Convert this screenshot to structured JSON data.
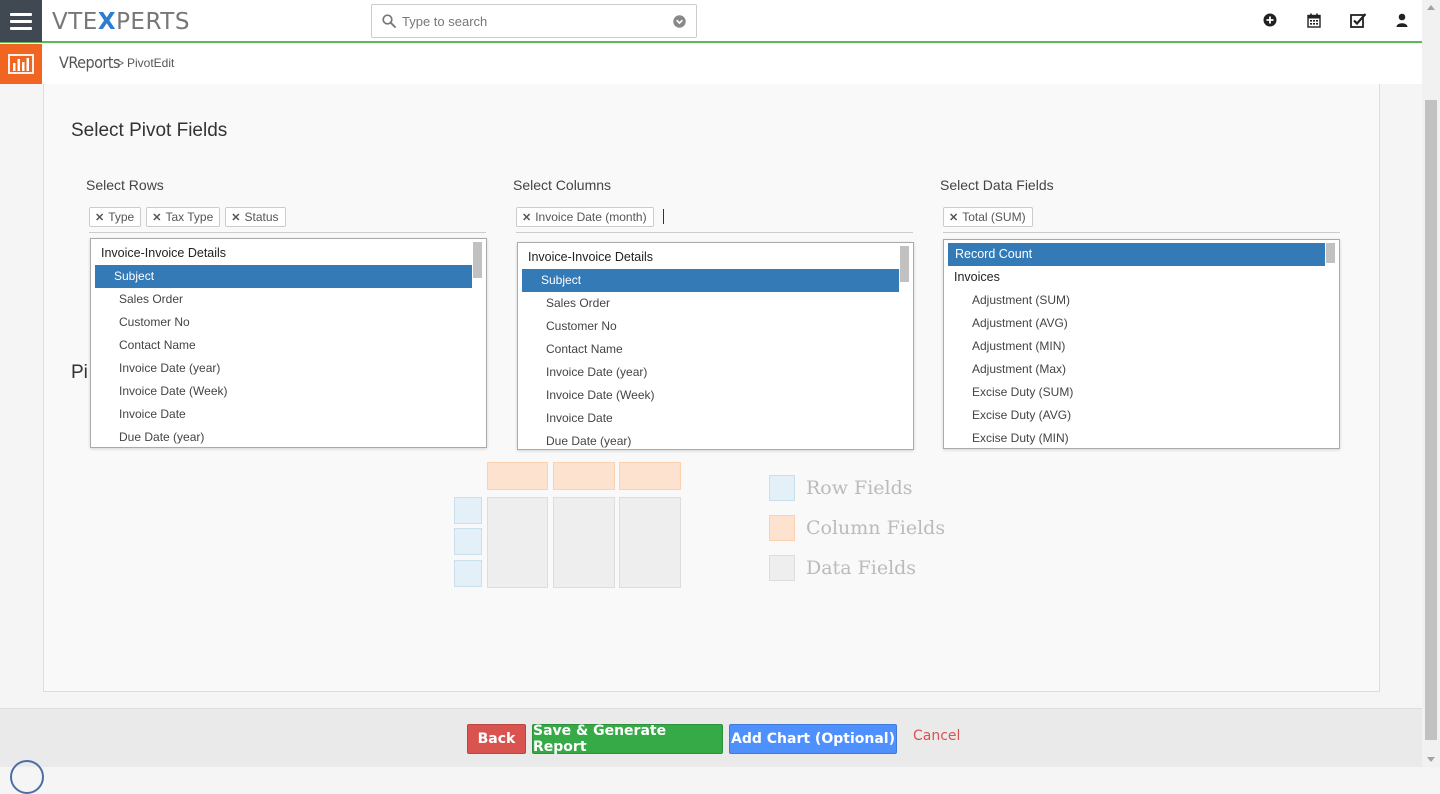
{
  "header": {
    "logo_prefix": "VTE",
    "logo_x": "X",
    "logo_suffix": "PERTS",
    "search_placeholder": "Type to search",
    "icons": [
      "add-icon",
      "calendar-icon",
      "tasks-icon",
      "user-icon"
    ]
  },
  "breadcrumb": {
    "module": "VReports",
    "separator": ">",
    "page": "PivotEdit"
  },
  "main": {
    "title": "Select Pivot Fields",
    "partial_heading": "Pi",
    "rows": {
      "label": "Select Rows",
      "chips": [
        "Type",
        "Tax Type",
        "Status"
      ],
      "items": [
        {
          "label": "Invoice-Invoice Details",
          "group": true
        },
        {
          "label": "Subject",
          "selected": true
        },
        {
          "label": "Sales Order"
        },
        {
          "label": "Customer No"
        },
        {
          "label": "Contact Name"
        },
        {
          "label": "Invoice Date (year)"
        },
        {
          "label": "Invoice Date (Week)"
        },
        {
          "label": "Invoice Date"
        },
        {
          "label": "Due Date (year)"
        }
      ]
    },
    "columns": {
      "label": "Select Columns",
      "chips": [
        "Invoice Date (month)"
      ],
      "items": [
        {
          "label": "Invoice-Invoice Details",
          "group": true
        },
        {
          "label": "Subject",
          "selected": true
        },
        {
          "label": "Sales Order"
        },
        {
          "label": "Customer No"
        },
        {
          "label": "Contact Name"
        },
        {
          "label": "Invoice Date (year)"
        },
        {
          "label": "Invoice Date (Week)"
        },
        {
          "label": "Invoice Date"
        },
        {
          "label": "Due Date (year)"
        }
      ]
    },
    "data_fields": {
      "label": "Select Data Fields",
      "chips": [
        "Total (SUM)"
      ],
      "items": [
        {
          "label": "Record Count",
          "group": true,
          "selected": true
        },
        {
          "label": "Invoices",
          "group": true
        },
        {
          "label": "Adjustment (SUM)"
        },
        {
          "label": "Adjustment (AVG)"
        },
        {
          "label": "Adjustment (MIN)"
        },
        {
          "label": "Adjustment (Max)"
        },
        {
          "label": "Excise Duty (SUM)"
        },
        {
          "label": "Excise Duty (AVG)"
        },
        {
          "label": "Excise Duty (MIN)"
        }
      ]
    },
    "legend": {
      "row": "Row Fields",
      "column": "Column Fields",
      "data": "Data Fields"
    }
  },
  "footer": {
    "back": "Back",
    "save": "Save & Generate Report",
    "add_chart": "Add Chart (Optional)",
    "cancel": "Cancel"
  },
  "colors": {
    "primary_selected": "#337ab7",
    "topbar_accent": "#5cb85c",
    "app_icon": "#f06522",
    "back": "#d9534f",
    "save": "#35aa47",
    "chart": "#4d90fe"
  }
}
